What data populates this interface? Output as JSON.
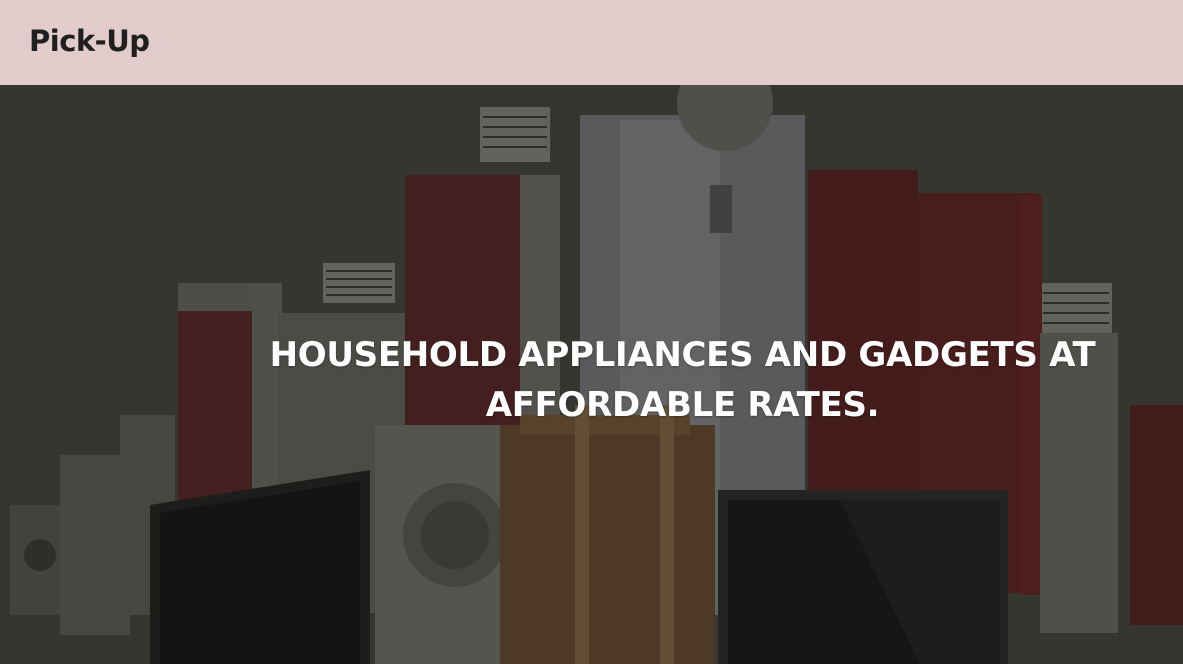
{
  "header": {
    "brand": "Pick-Up",
    "background_color": "#e2cbcb"
  },
  "hero": {
    "headline": "HOUSEHOLD APPLIANCES AND GADGETS AT AFFORDABLE RATES.",
    "image": "household-appliances-collage",
    "text_color": "#ffffff"
  }
}
